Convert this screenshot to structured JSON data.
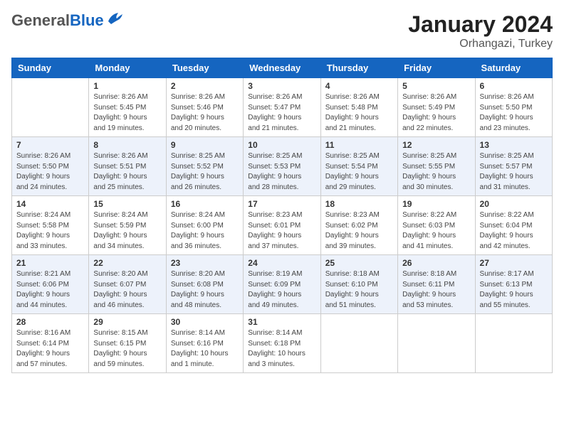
{
  "header": {
    "logo_general": "General",
    "logo_blue": "Blue",
    "month": "January 2024",
    "location": "Orhangazi, Turkey"
  },
  "days_of_week": [
    "Sunday",
    "Monday",
    "Tuesday",
    "Wednesday",
    "Thursday",
    "Friday",
    "Saturday"
  ],
  "weeks": [
    [
      {
        "day": "",
        "info": ""
      },
      {
        "day": "1",
        "info": "Sunrise: 8:26 AM\nSunset: 5:45 PM\nDaylight: 9 hours\nand 19 minutes."
      },
      {
        "day": "2",
        "info": "Sunrise: 8:26 AM\nSunset: 5:46 PM\nDaylight: 9 hours\nand 20 minutes."
      },
      {
        "day": "3",
        "info": "Sunrise: 8:26 AM\nSunset: 5:47 PM\nDaylight: 9 hours\nand 21 minutes."
      },
      {
        "day": "4",
        "info": "Sunrise: 8:26 AM\nSunset: 5:48 PM\nDaylight: 9 hours\nand 21 minutes."
      },
      {
        "day": "5",
        "info": "Sunrise: 8:26 AM\nSunset: 5:49 PM\nDaylight: 9 hours\nand 22 minutes."
      },
      {
        "day": "6",
        "info": "Sunrise: 8:26 AM\nSunset: 5:50 PM\nDaylight: 9 hours\nand 23 minutes."
      }
    ],
    [
      {
        "day": "7",
        "info": "Sunrise: 8:26 AM\nSunset: 5:50 PM\nDaylight: 9 hours\nand 24 minutes."
      },
      {
        "day": "8",
        "info": "Sunrise: 8:26 AM\nSunset: 5:51 PM\nDaylight: 9 hours\nand 25 minutes."
      },
      {
        "day": "9",
        "info": "Sunrise: 8:25 AM\nSunset: 5:52 PM\nDaylight: 9 hours\nand 26 minutes."
      },
      {
        "day": "10",
        "info": "Sunrise: 8:25 AM\nSunset: 5:53 PM\nDaylight: 9 hours\nand 28 minutes."
      },
      {
        "day": "11",
        "info": "Sunrise: 8:25 AM\nSunset: 5:54 PM\nDaylight: 9 hours\nand 29 minutes."
      },
      {
        "day": "12",
        "info": "Sunrise: 8:25 AM\nSunset: 5:55 PM\nDaylight: 9 hours\nand 30 minutes."
      },
      {
        "day": "13",
        "info": "Sunrise: 8:25 AM\nSunset: 5:57 PM\nDaylight: 9 hours\nand 31 minutes."
      }
    ],
    [
      {
        "day": "14",
        "info": "Sunrise: 8:24 AM\nSunset: 5:58 PM\nDaylight: 9 hours\nand 33 minutes."
      },
      {
        "day": "15",
        "info": "Sunrise: 8:24 AM\nSunset: 5:59 PM\nDaylight: 9 hours\nand 34 minutes."
      },
      {
        "day": "16",
        "info": "Sunrise: 8:24 AM\nSunset: 6:00 PM\nDaylight: 9 hours\nand 36 minutes."
      },
      {
        "day": "17",
        "info": "Sunrise: 8:23 AM\nSunset: 6:01 PM\nDaylight: 9 hours\nand 37 minutes."
      },
      {
        "day": "18",
        "info": "Sunrise: 8:23 AM\nSunset: 6:02 PM\nDaylight: 9 hours\nand 39 minutes."
      },
      {
        "day": "19",
        "info": "Sunrise: 8:22 AM\nSunset: 6:03 PM\nDaylight: 9 hours\nand 41 minutes."
      },
      {
        "day": "20",
        "info": "Sunrise: 8:22 AM\nSunset: 6:04 PM\nDaylight: 9 hours\nand 42 minutes."
      }
    ],
    [
      {
        "day": "21",
        "info": "Sunrise: 8:21 AM\nSunset: 6:06 PM\nDaylight: 9 hours\nand 44 minutes."
      },
      {
        "day": "22",
        "info": "Sunrise: 8:20 AM\nSunset: 6:07 PM\nDaylight: 9 hours\nand 46 minutes."
      },
      {
        "day": "23",
        "info": "Sunrise: 8:20 AM\nSunset: 6:08 PM\nDaylight: 9 hours\nand 48 minutes."
      },
      {
        "day": "24",
        "info": "Sunrise: 8:19 AM\nSunset: 6:09 PM\nDaylight: 9 hours\nand 49 minutes."
      },
      {
        "day": "25",
        "info": "Sunrise: 8:18 AM\nSunset: 6:10 PM\nDaylight: 9 hours\nand 51 minutes."
      },
      {
        "day": "26",
        "info": "Sunrise: 8:18 AM\nSunset: 6:11 PM\nDaylight: 9 hours\nand 53 minutes."
      },
      {
        "day": "27",
        "info": "Sunrise: 8:17 AM\nSunset: 6:13 PM\nDaylight: 9 hours\nand 55 minutes."
      }
    ],
    [
      {
        "day": "28",
        "info": "Sunrise: 8:16 AM\nSunset: 6:14 PM\nDaylight: 9 hours\nand 57 minutes."
      },
      {
        "day": "29",
        "info": "Sunrise: 8:15 AM\nSunset: 6:15 PM\nDaylight: 9 hours\nand 59 minutes."
      },
      {
        "day": "30",
        "info": "Sunrise: 8:14 AM\nSunset: 6:16 PM\nDaylight: 10 hours\nand 1 minute."
      },
      {
        "day": "31",
        "info": "Sunrise: 8:14 AM\nSunset: 6:18 PM\nDaylight: 10 hours\nand 3 minutes."
      },
      {
        "day": "",
        "info": ""
      },
      {
        "day": "",
        "info": ""
      },
      {
        "day": "",
        "info": ""
      }
    ]
  ]
}
